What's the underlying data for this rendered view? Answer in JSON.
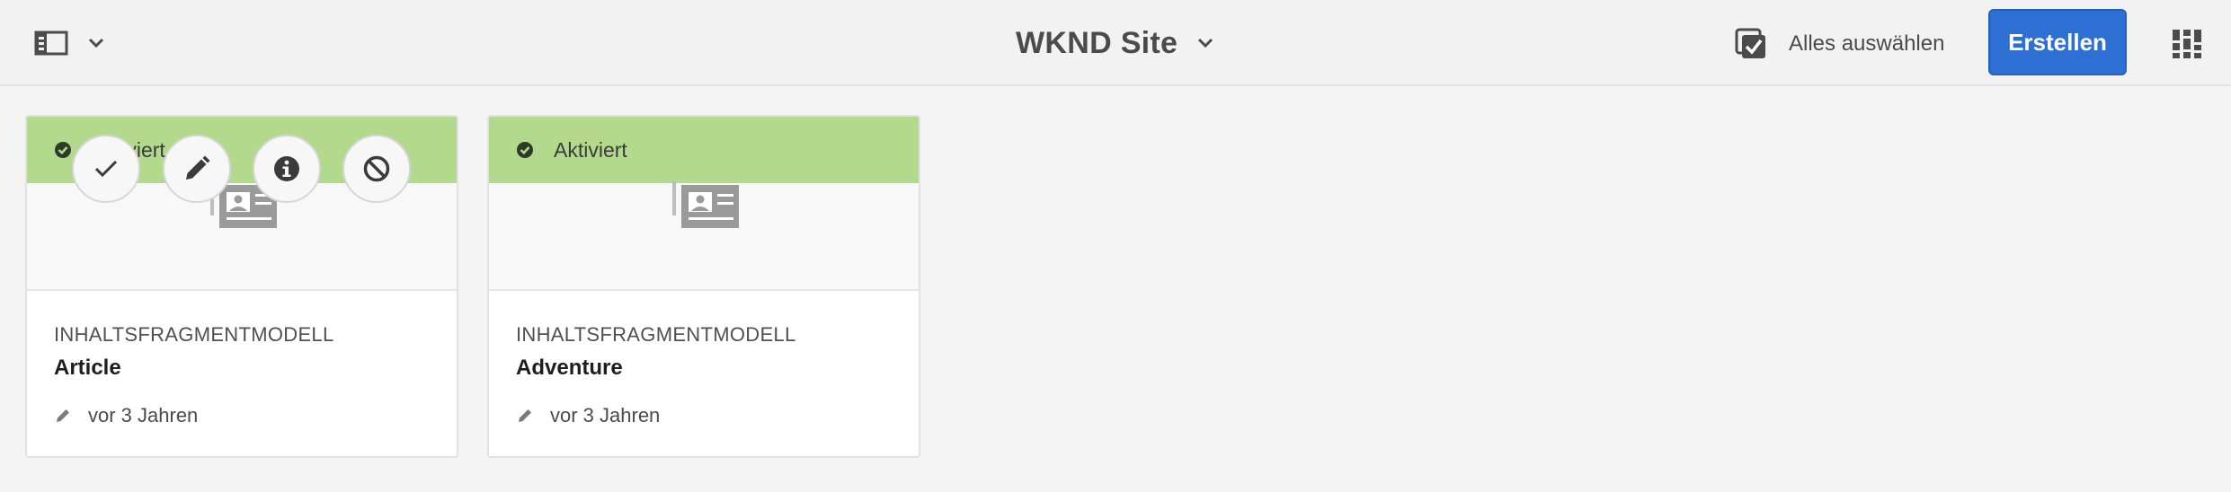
{
  "header": {
    "title": "WKND Site",
    "select_all_label": "Alles auswählen",
    "create_label": "Erstellen",
    "icons": {
      "rail": "rail-toggle-icon",
      "rail_chevron": "chevron-down-icon",
      "title_chevron": "chevron-down-icon",
      "select_all": "select-all-checkbox-icon",
      "view": "card-view-icon"
    }
  },
  "cards": [
    {
      "status": "Aktiviert",
      "type": "INHALTSFRAGMENTMODELL",
      "name": "Article",
      "modified": "vor 3 Jahren",
      "quick_actions": [
        "select-icon",
        "edit-icon",
        "info-icon",
        "disable-icon"
      ]
    },
    {
      "status": "Aktiviert",
      "type": "INHALTSFRAGMENTMODELL",
      "name": "Adventure",
      "modified": "vor 3 Jahren"
    }
  ],
  "colors": {
    "status_active": "#b3d98c",
    "accent": "#2d6fd2",
    "background": "#f4f4f4"
  }
}
